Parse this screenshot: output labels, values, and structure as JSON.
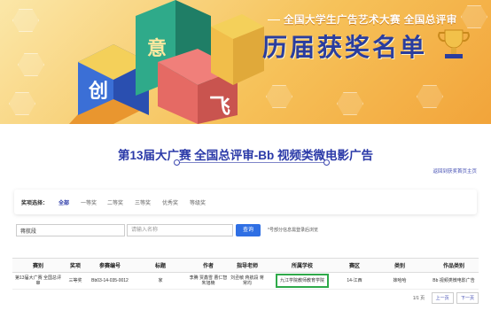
{
  "banner": {
    "subtitle": "全国大学生广告艺术大赛 全国总评审",
    "title": "历届获奖名单"
  },
  "page_title": "第13届大广赛 全国总评审-Bb 视频类微电影广告",
  "back_link": "返回到获奖首页主页",
  "filter": {
    "label": "奖项选择：",
    "chips": [
      "全部",
      "一等奖",
      "二等奖",
      "三等奖",
      "优秀奖",
      "等级奖"
    ],
    "active": "全部"
  },
  "search": {
    "school_value": "蒋航段",
    "name_placeholder": "请输入名称",
    "button_label": "查询",
    "hint": "*号部分信息需登录后浏览"
  },
  "table": {
    "headers": [
      "赛别",
      "奖项",
      "参赛编号",
      "标题",
      "作者",
      "指导老师",
      "所属学校",
      "赛区",
      "类别",
      "作品类别"
    ],
    "rows": [
      [
        "第13届大广赛 全国总评审",
        "三等奖",
        "Bb03-14-035-0012",
        "家",
        "李腾 贾鑫雪 曹仁智 朱旭楠",
        "刘丞敏 蒋航段 蒋 常均",
        "九江学院教师教育学院",
        "14-江西",
        "妹哈哈",
        "Bb 视频类微电影广告"
      ]
    ]
  },
  "pagination": {
    "info": "1/1 页",
    "prev": "上一页",
    "next": "下一页"
  },
  "colors": {
    "brand_blue": "#2b3aa8",
    "button_blue": "#2f6fe4",
    "highlight_green": "#2faa4a",
    "banner_yellow": "#f6c25a"
  }
}
